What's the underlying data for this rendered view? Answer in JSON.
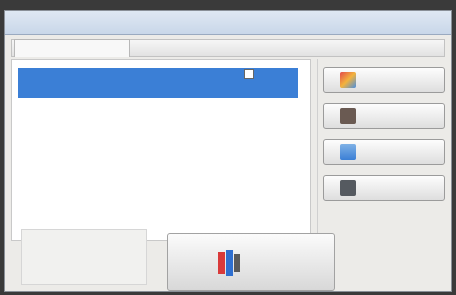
{
  "window": {
    "title": ""
  },
  "tabs": [
    {
      "label": ""
    }
  ],
  "list": {
    "items": [
      {
        "label": "",
        "checked": false,
        "selected": true
      }
    ]
  },
  "buttons": {
    "button_1": {
      "label": "",
      "icon": "colorful-file-icon"
    },
    "button_2": {
      "label": "",
      "icon": "folder-icon"
    },
    "button_3": {
      "label": "",
      "icon": "image-icon"
    },
    "button_4": {
      "label": "",
      "icon": "document-icon"
    },
    "main_button": {
      "label": "",
      "icon": "app-icon"
    }
  },
  "colors": {
    "selection": "#3b7fd6",
    "window_bg": "#ecebe8"
  }
}
